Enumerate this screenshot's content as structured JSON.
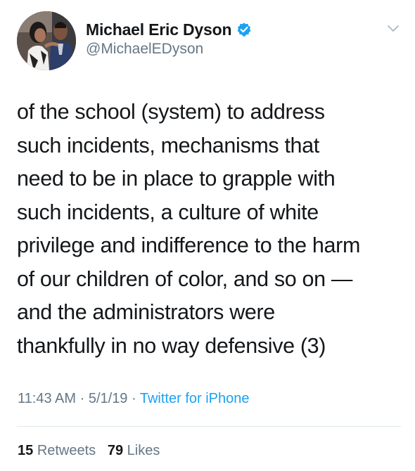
{
  "author": {
    "display_name": "Michael Eric Dyson",
    "handle": "@MichaelEDyson",
    "verified": true,
    "avatar_icon": "profile-photo"
  },
  "tweet": {
    "lines": [
      "of the school (system) to address",
      "such incidents, mechanisms that",
      "need to be in place to grapple with",
      "such incidents, a culture of white",
      "privilege and indifference to the harm",
      "of our children of color, and so on —",
      "and the administrators were",
      "thankfully in no way defensive (3)"
    ]
  },
  "meta": {
    "time": "11:43 AM",
    "separator": "·",
    "date": "5/1/19",
    "source": "Twitter for iPhone"
  },
  "stats": {
    "retweets_count": "15",
    "retweets_label": "Retweets",
    "likes_count": "79",
    "likes_label": "Likes"
  },
  "colors": {
    "text": "#14171a",
    "secondary": "#657786",
    "accent": "#1da1f2",
    "divider": "#e1e8ed"
  }
}
